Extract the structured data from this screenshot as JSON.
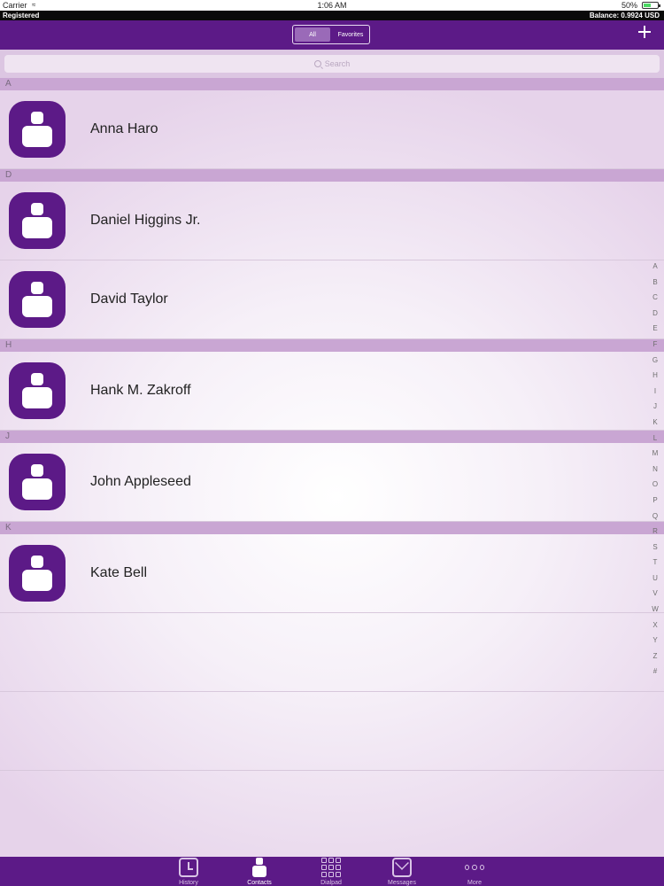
{
  "status_bar": {
    "carrier": "Carrier",
    "time": "1:06 AM",
    "battery": "50%"
  },
  "account": {
    "registration": "Registered",
    "balance": "Balance: 0.9924 USD"
  },
  "nav": {
    "segments": [
      "All",
      "Favorites"
    ],
    "active_segment": "All"
  },
  "search": {
    "placeholder": "Search"
  },
  "sections": [
    {
      "letter": "A",
      "contacts": [
        "Anna Haro"
      ]
    },
    {
      "letter": "D",
      "contacts": [
        "Daniel Higgins Jr.",
        "David Taylor"
      ]
    },
    {
      "letter": "H",
      "contacts": [
        "Hank M. Zakroff"
      ]
    },
    {
      "letter": "J",
      "contacts": [
        "John Appleseed"
      ]
    },
    {
      "letter": "K",
      "contacts": [
        "Kate Bell"
      ]
    }
  ],
  "index_letters": [
    "A",
    "B",
    "C",
    "D",
    "E",
    "F",
    "G",
    "H",
    "I",
    "J",
    "K",
    "L",
    "M",
    "N",
    "O",
    "P",
    "Q",
    "R",
    "S",
    "T",
    "U",
    "V",
    "W",
    "X",
    "Y",
    "Z",
    "#"
  ],
  "tabs": [
    {
      "label": "History",
      "icon": "history-icon"
    },
    {
      "label": "Contacts",
      "icon": "contacts-icon"
    },
    {
      "label": "Dialpad",
      "icon": "keypad-icon"
    },
    {
      "label": "Messages",
      "icon": "messages-icon"
    },
    {
      "label": "More",
      "icon": "more-icon"
    }
  ],
  "active_tab": "Contacts",
  "colors": {
    "brand_purple": "#5c1a87",
    "section_header": "#c9a6d3"
  }
}
